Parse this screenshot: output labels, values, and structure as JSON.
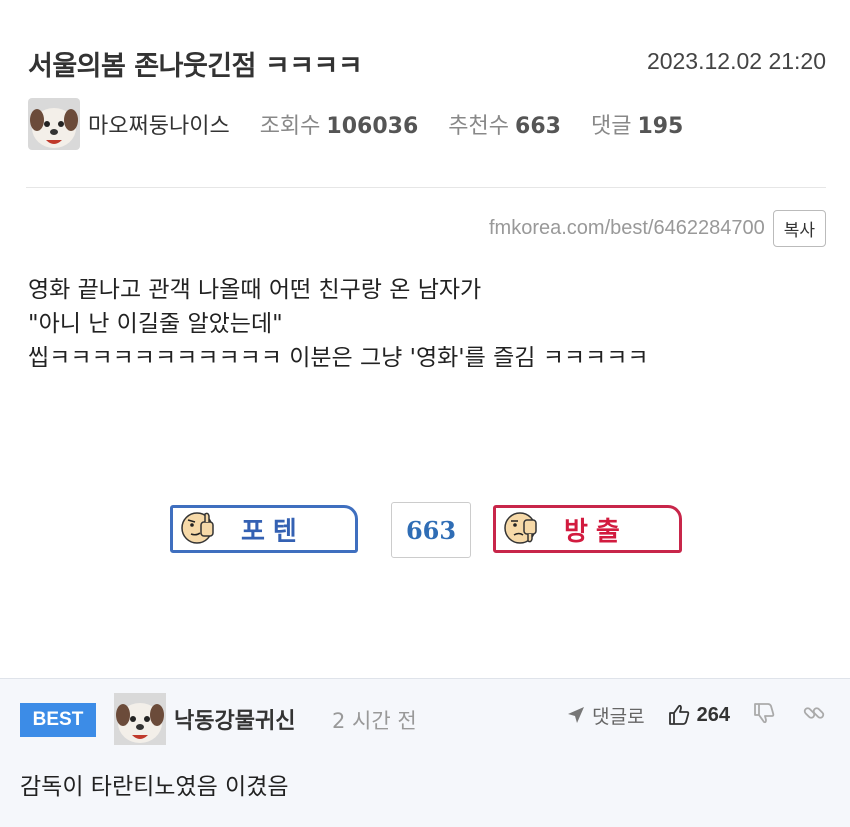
{
  "post": {
    "title": "서울의봄 존나웃긴점 ㅋㅋㅋㅋ",
    "date": "2023.12.02 21:20",
    "author": "마오쩌둥나이스",
    "views_label": "조회수",
    "views": "106036",
    "recommend_label": "추천수",
    "recommend": "663",
    "comments_label": "댓글",
    "comments": "195",
    "url": "fmkorea.com/best/6462284700",
    "copy_label": "복사",
    "body_lines": [
      "영화 끝나고 관객 나올때 어떤 친구랑 온 남자가",
      "\"아니 난 이길줄 알았는데\"",
      "씹ㅋㅋㅋㅋㅋㅋㅋㅋㅋㅋㅋ 이분은 그냥 '영화'를 즐김 ㅋㅋㅋㅋㅋ"
    ]
  },
  "vote": {
    "up_label": "포텐",
    "count": "663",
    "down_label": "방출"
  },
  "comment": {
    "badge": "BEST",
    "author": "낙동강물귀신",
    "time": "2 시간 전",
    "reply_label": "댓글로",
    "likes": "264",
    "text": "감독이 타란티노였음 이겼음"
  },
  "colors": {
    "accent_blue": "#3461b3",
    "accent_red": "#d21b3f",
    "best_badge": "#3c8ce7"
  }
}
